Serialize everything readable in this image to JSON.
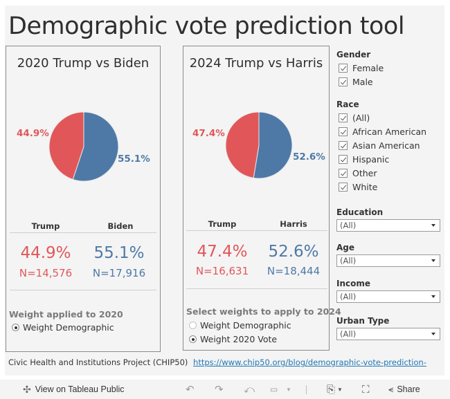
{
  "title": "Demographic vote prediction tool",
  "colors": {
    "trump": "#e15759",
    "dem": "#4e79a7"
  },
  "panels": [
    {
      "title": "2020 Trump vs Biden",
      "pie_labels": {
        "left": "44.9%",
        "right": "55.1%"
      },
      "columns": [
        {
          "name": "Trump",
          "pct": "44.9%",
          "n": "N=14,576"
        },
        {
          "name": "Biden",
          "pct": "55.1%",
          "n": "N=17,916"
        }
      ],
      "weights_label": "Weight applied to 2020",
      "weights": [
        {
          "label": "Weight Demographic",
          "selected": true
        }
      ]
    },
    {
      "title": "2024 Trump vs Harris",
      "pie_labels": {
        "left": "47.4%",
        "right": "52.6%"
      },
      "columns": [
        {
          "name": "Trump",
          "pct": "47.4%",
          "n": "N=16,631"
        },
        {
          "name": "Harris",
          "pct": "52.6%",
          "n": "N=18,444"
        }
      ],
      "weights_label": "Select weights to apply to 2024",
      "weights": [
        {
          "label": "Weight Demographic",
          "selected": false
        },
        {
          "label": "Weight 2020 Vote",
          "selected": true
        }
      ]
    }
  ],
  "chart_data": [
    {
      "type": "pie",
      "title": "2020 Trump vs Biden",
      "categories": [
        "Trump",
        "Biden"
      ],
      "values": [
        44.9,
        55.1
      ],
      "colors": [
        "#e15759",
        "#4e79a7"
      ]
    },
    {
      "type": "pie",
      "title": "2024 Trump vs Harris",
      "categories": [
        "Trump",
        "Harris"
      ],
      "values": [
        47.4,
        52.6
      ],
      "colors": [
        "#e15759",
        "#4e79a7"
      ]
    }
  ],
  "filters": {
    "gender": {
      "label": "Gender",
      "options": [
        "Female",
        "Male"
      ]
    },
    "race": {
      "label": "Race",
      "options": [
        "(All)",
        "African American",
        "Asian American",
        "Hispanic",
        "Other",
        "White"
      ]
    },
    "education": {
      "label": "Education",
      "value": "(All)"
    },
    "age": {
      "label": "Age",
      "value": "(All)"
    },
    "income": {
      "label": "Income",
      "value": "(All)"
    },
    "urban": {
      "label": "Urban Type",
      "value": "(All)"
    }
  },
  "source": {
    "text": "Civic Health and Institutions Project (CHIP50)",
    "link": "https://www.chip50.org/blog/demographic-vote-prediction-"
  },
  "toolbar": {
    "view_label": "View on Tableau Public",
    "share_label": "Share"
  }
}
